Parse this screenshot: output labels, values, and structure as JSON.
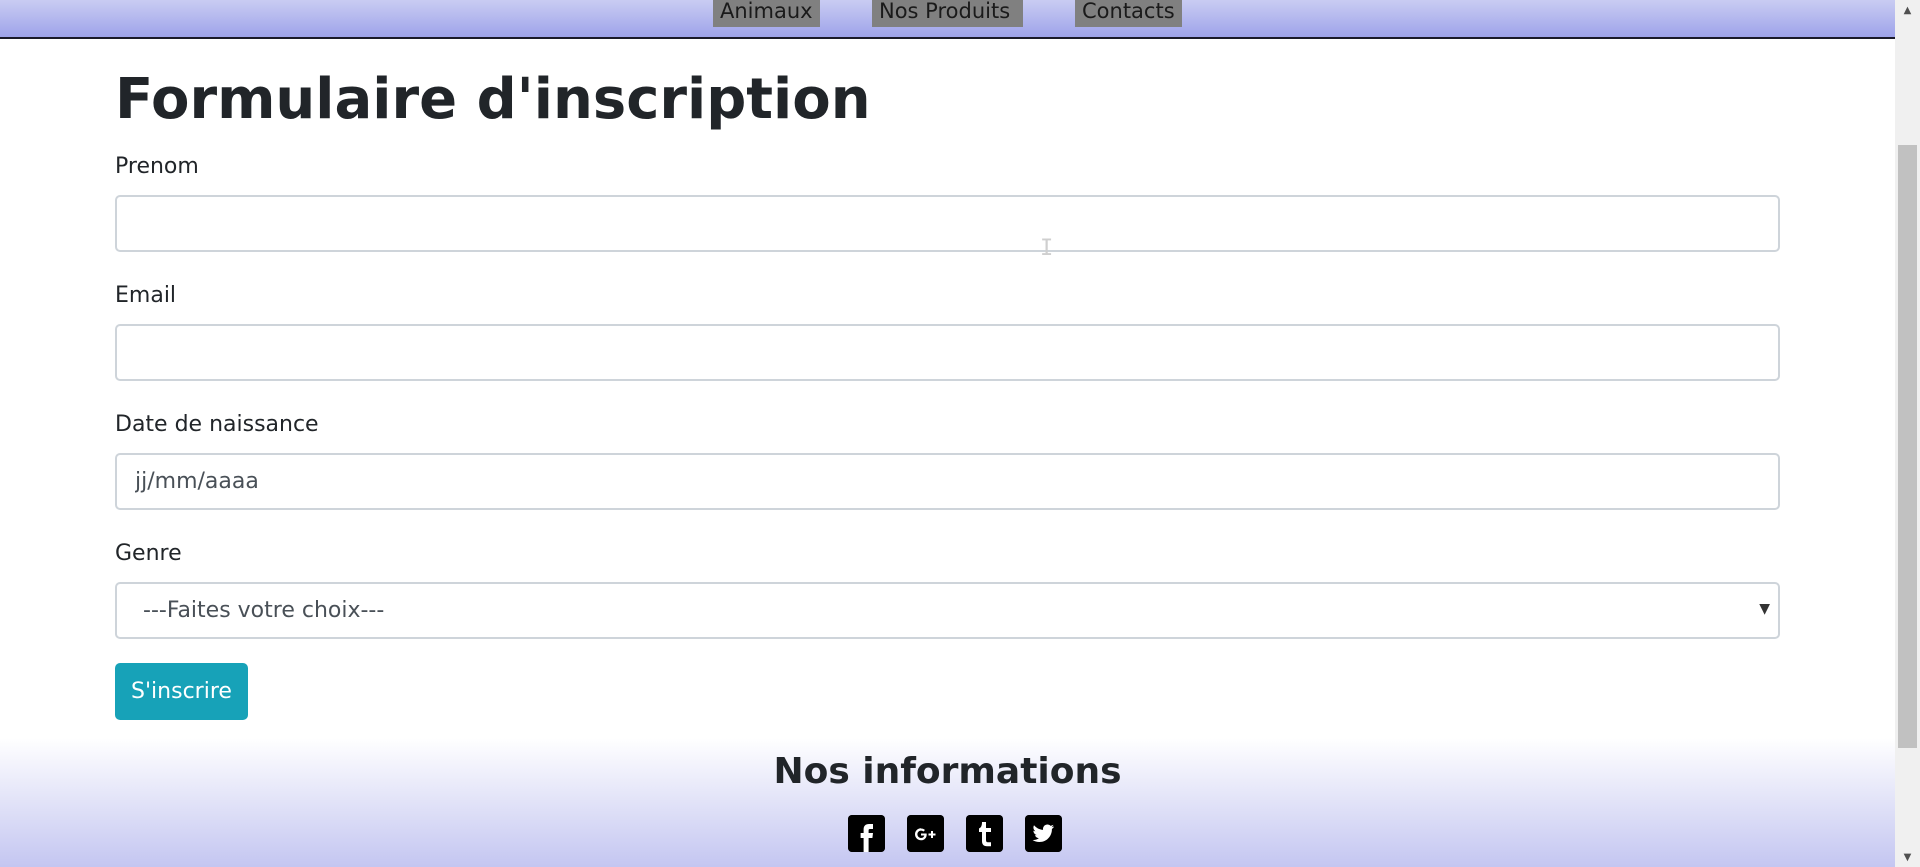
{
  "nav": {
    "items": [
      {
        "label": "Animaux"
      },
      {
        "label": "Nos Produits"
      },
      {
        "label": "Contacts"
      }
    ]
  },
  "form": {
    "title": "Formulaire d'inscription",
    "fields": {
      "prenom": {
        "label": "Prenom",
        "value": "",
        "placeholder": ""
      },
      "email": {
        "label": "Email",
        "value": "",
        "placeholder": ""
      },
      "birthdate": {
        "label": "Date de naissance",
        "placeholder": "jj/mm/aaaa"
      },
      "genre": {
        "label": "Genre",
        "selected": "---Faites votre choix---"
      }
    },
    "submit_label": "S'inscrire"
  },
  "footer": {
    "title": "Nos informations",
    "social": [
      {
        "icon": "facebook-icon",
        "glyph": "f"
      },
      {
        "icon": "google-plus-icon",
        "glyph": "G+"
      },
      {
        "icon": "tumblr-icon",
        "glyph": "t"
      },
      {
        "icon": "twitter-icon",
        "glyph": "🐦"
      }
    ]
  },
  "colors": {
    "nav_gradient_top": "#c9ccf2",
    "nav_gradient_bottom": "#9ea3ea",
    "nav_item_bg": "#808080",
    "submit_button": "#17a2b8",
    "footer_gradient_bottom": "#c4c6f1"
  }
}
